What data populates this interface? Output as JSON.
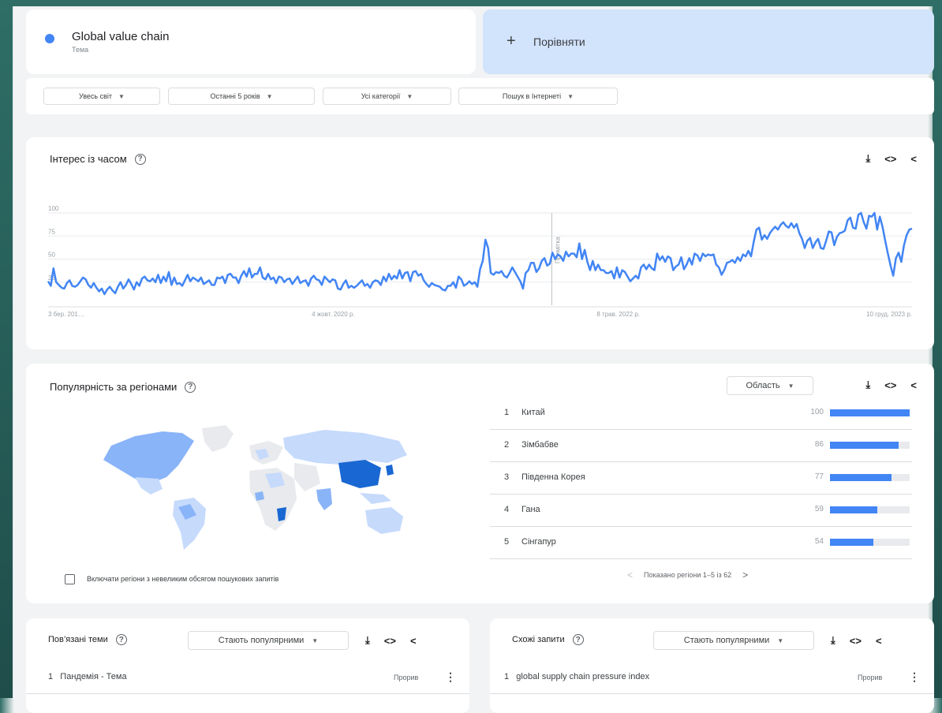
{
  "search_term": {
    "name": "Global value chain",
    "type": "Тема",
    "color": "#4285f4"
  },
  "compare": {
    "plus": "+",
    "label": "Порівняти"
  },
  "filters": [
    {
      "label": "Увесь світ"
    },
    {
      "label": "Останні 5 років"
    },
    {
      "label": "Усі категорії"
    },
    {
      "label": "Пошук в Інтернеті"
    }
  ],
  "interest_over_time": {
    "title": "Інтерес із часом",
    "note_label": "Примітка"
  },
  "chart_data": {
    "type": "line",
    "title": "Інтерес із часом",
    "xlabel": "",
    "ylabel": "",
    "ylim": [
      0,
      100
    ],
    "y_ticks": [
      25,
      50,
      75,
      100
    ],
    "x_tick_labels": [
      "3 бер. 201…",
      "4 жовт. 2020 р.",
      "8 трав. 2022 р.",
      "10 груд. 2023 р."
    ],
    "grid": true,
    "color": "#4285f4",
    "series": [
      {
        "values": [
          26,
          21,
          40,
          25,
          22,
          19,
          18,
          24,
          27,
          21,
          20,
          22,
          26,
          30,
          28,
          22,
          19,
          24,
          19,
          15,
          18,
          12,
          17,
          20,
          16,
          13,
          20,
          25,
          18,
          22,
          28,
          23,
          17,
          25,
          21,
          29,
          31,
          27,
          26,
          29,
          25,
          33,
          24,
          31,
          26,
          36,
          22,
          30,
          23,
          24,
          21,
          27,
          33,
          26,
          30,
          28,
          26,
          30,
          23,
          25,
          27,
          22,
          22,
          30,
          29,
          31,
          24,
          33,
          34,
          30,
          30,
          24,
          32,
          37,
          31,
          40,
          30,
          34,
          34,
          41,
          30,
          28,
          34,
          28,
          30,
          24,
          31,
          30,
          25,
          28,
          29,
          23,
          27,
          31,
          24,
          26,
          27,
          21,
          29,
          32,
          28,
          27,
          22,
          31,
          28,
          25,
          28,
          27,
          18,
          17,
          23,
          27,
          19,
          21,
          19,
          21,
          24,
          27,
          21,
          23,
          19,
          25,
          27,
          26,
          22,
          31,
          26,
          34,
          28,
          32,
          29,
          38,
          29,
          35,
          36,
          26,
          36,
          37,
          32,
          34,
          27,
          23,
          20,
          24,
          22,
          21,
          20,
          17,
          16,
          21,
          21,
          25,
          19,
          31,
          28,
          21,
          23,
          26,
          23,
          25,
          20,
          39,
          48,
          71,
          62,
          35,
          33,
          36,
          35,
          37,
          32,
          30,
          35,
          41,
          36,
          31,
          26,
          18,
          35,
          38,
          46,
          46,
          36,
          40,
          48,
          51,
          43,
          45,
          57,
          50,
          55,
          53,
          48,
          58,
          53,
          56,
          56,
          52,
          67,
          50,
          60,
          47,
          38,
          48,
          38,
          44,
          38,
          38,
          35,
          35,
          37,
          29,
          41,
          30,
          38,
          36,
          31,
          26,
          29,
          32,
          29,
          41,
          44,
          39,
          44,
          40,
          38,
          56,
          49,
          53,
          47,
          53,
          51,
          38,
          42,
          44,
          52,
          39,
          44,
          51,
          44,
          56,
          54,
          48,
          56,
          53,
          55,
          54,
          55,
          44,
          41,
          33,
          38,
          46,
          47,
          49,
          46,
          52,
          48,
          55,
          53,
          59,
          53,
          69,
          82,
          84,
          71,
          76,
          72,
          78,
          82,
          85,
          82,
          87,
          90,
          86,
          84,
          89,
          84,
          88,
          78,
          72,
          62,
          70,
          73,
          62,
          68,
          72,
          62,
          61,
          70,
          80,
          79,
          65,
          74,
          78,
          79,
          81,
          92,
          95,
          84,
          83,
          98,
          100,
          90,
          83,
          97,
          96,
          100,
          82,
          96,
          85,
          70,
          56,
          43,
          32,
          51,
          57,
          47,
          65,
          76,
          82,
          83
        ]
      }
    ]
  },
  "regions": {
    "title": "Популярність за регіонами",
    "dropdown": "Область",
    "items": [
      {
        "rank": "1",
        "name": "Китай",
        "value": 100
      },
      {
        "rank": "2",
        "name": "Зімбабве",
        "value": 86
      },
      {
        "rank": "3",
        "name": "Південна Корея",
        "value": 77
      },
      {
        "rank": "4",
        "name": "Гана",
        "value": 59
      },
      {
        "rank": "5",
        "name": "Сінгапур",
        "value": 54
      }
    ],
    "checkbox_label": "Включати регіони з невеликим обсягом пошукових запитів",
    "pager_text": "Показано регіони 1–5 із 62",
    "map_colors": {
      "high": "#1967d2",
      "mid": "#8ab4f8",
      "low": "#c6dafc",
      "none": "#e8eaed"
    }
  },
  "related_topics": {
    "title": "Пов’язані теми",
    "dropdown": "Стають популярними",
    "rows": [
      {
        "rank": "1",
        "text": "Пандемія - Тема",
        "badge": "Прорив"
      }
    ]
  },
  "related_queries": {
    "title": "Схожі запити",
    "dropdown": "Стають популярними",
    "rows": [
      {
        "rank": "1",
        "text": "global supply chain pressure index",
        "badge": "Прорив"
      }
    ]
  }
}
